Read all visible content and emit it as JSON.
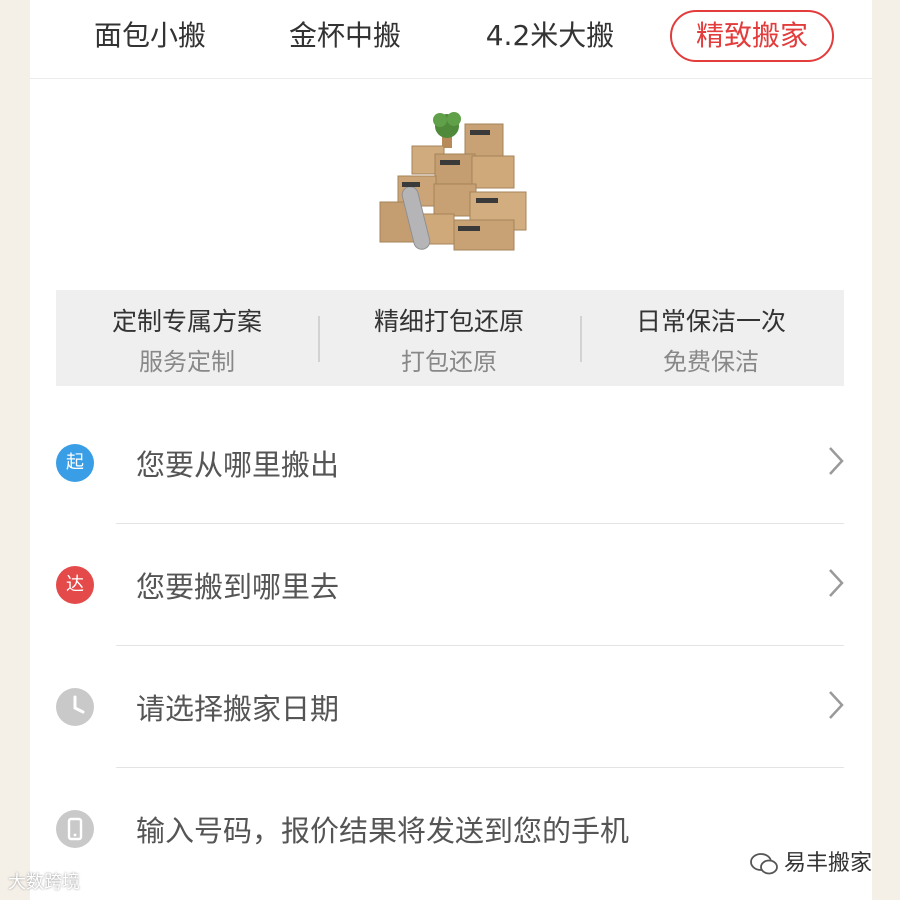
{
  "tabs": [
    {
      "label": "面包小搬"
    },
    {
      "label": "金杯中搬"
    },
    {
      "label": "4.2米大搬"
    },
    {
      "label": "精致搬家",
      "active": true
    }
  ],
  "features": [
    {
      "title": "定制专属方案",
      "subtitle": "服务定制"
    },
    {
      "title": "精细打包还原",
      "subtitle": "打包还原"
    },
    {
      "title": "日常保洁一次",
      "subtitle": "免费保洁"
    }
  ],
  "form": {
    "from": {
      "badge": "起",
      "placeholder": "您要从哪里搬出",
      "icon": "origin-badge",
      "color": "#3a9ee6"
    },
    "to": {
      "badge": "达",
      "placeholder": "您要搬到哪里去",
      "icon": "destination-badge",
      "color": "#e44a4a"
    },
    "date": {
      "placeholder": "请选择搬家日期",
      "icon": "clock-icon",
      "color": "#c9c9c9"
    },
    "phone": {
      "placeholder": "输入号码，报价结果将发送到您的手机",
      "icon": "phone-icon",
      "color": "#c9c9c9"
    }
  },
  "watermarks": {
    "left": "大数跨境",
    "right": "易丰搬家"
  },
  "colors": {
    "accent": "#e23c3c"
  }
}
